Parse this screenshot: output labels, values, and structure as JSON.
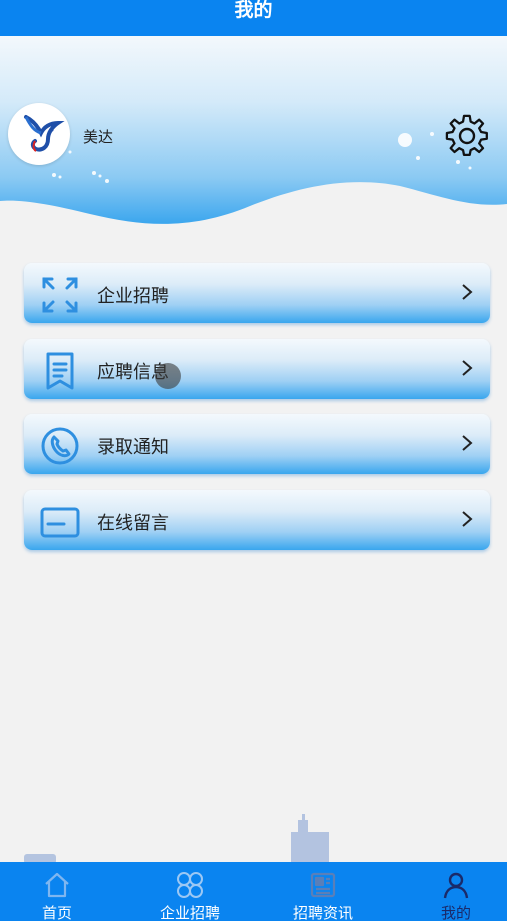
{
  "header": {
    "title": "我的"
  },
  "profile": {
    "username": "美达"
  },
  "icons": {
    "settings": "gear-icon",
    "avatar": "bird-logo"
  },
  "menu": [
    {
      "label": "企业招聘",
      "icon": "expand-icon"
    },
    {
      "label": "应聘信息",
      "icon": "document-icon"
    },
    {
      "label": "录取通知",
      "icon": "phone-icon"
    },
    {
      "label": "在线留言",
      "icon": "card-icon"
    }
  ],
  "tabbar": {
    "items": [
      {
        "label": "首页",
        "icon": "home-icon",
        "active": false
      },
      {
        "label": "企业招聘",
        "icon": "grid-icon",
        "active": false
      },
      {
        "label": "招聘资讯",
        "icon": "news-icon",
        "active": false
      },
      {
        "label": "我的",
        "icon": "user-icon",
        "active": true
      }
    ]
  },
  "colors": {
    "primary": "#0a84f0",
    "background": "#f2f2f2",
    "menu_gradient_bottom": "#39a6ee",
    "active_tab": "#1a2a6a"
  }
}
